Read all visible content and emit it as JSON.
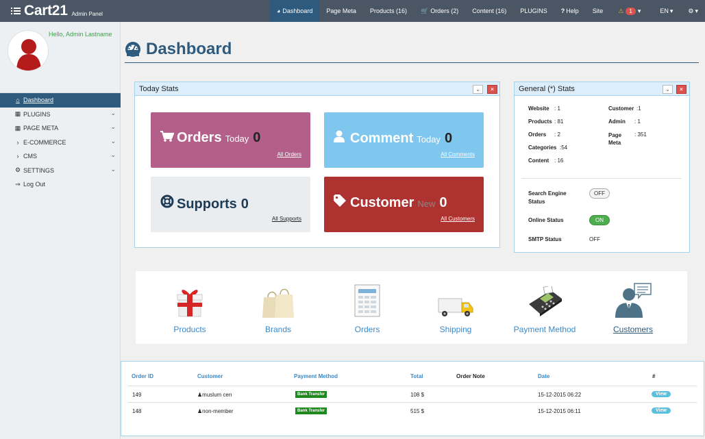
{
  "brand": {
    "title": "Cart21",
    "subtitle": "Admin Panel"
  },
  "nav": [
    {
      "label": "Dashboard",
      "icon": "gauge-icon"
    },
    {
      "label": "Page Meta"
    },
    {
      "label": "Products (16)"
    },
    {
      "label": "Orders (2)",
      "icon": "cart-icon"
    },
    {
      "label": "Content (16)"
    },
    {
      "label": "PLUGINS"
    },
    {
      "label": "Help",
      "icon": "question-icon"
    },
    {
      "label": "Site"
    },
    {
      "label": "1",
      "icon": "warning-icon"
    },
    {
      "label": "EN"
    },
    {
      "label": "",
      "icon": "gear-icon"
    }
  ],
  "sidebar": {
    "greeting": "Hello, Admin Lastname",
    "items": [
      {
        "label": "Dashboard",
        "icon": "home-icon"
      },
      {
        "label": "PLUGINS",
        "icon": "table-icon"
      },
      {
        "label": "PAGE META",
        "icon": "table-icon"
      },
      {
        "label": "E-COMMERCE",
        "icon": "chevron-right-icon"
      },
      {
        "label": "CMS",
        "icon": "chevron-right-icon"
      },
      {
        "label": "SETTINGS",
        "icon": "gear-icon"
      },
      {
        "label": "Log Out",
        "icon": "logout-icon"
      }
    ]
  },
  "page": {
    "title": "Dashboard"
  },
  "today_stats": {
    "title": "Today Stats",
    "tiles": [
      {
        "label": "Orders",
        "qualifier": "Today",
        "value": "0",
        "link": "All Orders",
        "color": "#b45f8a"
      },
      {
        "label": "Comment",
        "qualifier": "Today",
        "value": "0",
        "link": "All Comments",
        "color": "#7fc7ee"
      },
      {
        "label": "Supports",
        "qualifier": "",
        "value": "0",
        "link": "All Supports",
        "color": "#e9edf0"
      },
      {
        "label": "Customer",
        "qualifier": "New",
        "value": "0",
        "link": "All Customers",
        "color": "#ad3230"
      }
    ]
  },
  "general_stats": {
    "title": "General (*) Stats",
    "left": [
      {
        "key": "Website",
        "value": ": 1"
      },
      {
        "key": "Products",
        "value": ": 81"
      },
      {
        "key": "Orders",
        "value": ": 2"
      },
      {
        "key": "Categories",
        "value": ":54"
      },
      {
        "key": "Content",
        "value": ": 16"
      }
    ],
    "right": [
      {
        "key": "Customer",
        "value": ":1"
      },
      {
        "key": "Admin",
        "value": ": 1"
      },
      {
        "key": "Page Meta",
        "value": ": 351"
      }
    ],
    "settings": [
      {
        "key": "Search Engine Status",
        "value": "OFF"
      },
      {
        "key": "Online Status",
        "value": "ON"
      },
      {
        "key": "SMTP Status",
        "value": "OFF"
      }
    ]
  },
  "shortcuts": [
    {
      "label": "Products",
      "icon": "gift-box-icon"
    },
    {
      "label": "Brands",
      "icon": "shopping-bags-icon"
    },
    {
      "label": "Orders",
      "icon": "invoice-icon"
    },
    {
      "label": "Shipping",
      "icon": "delivery-truck-icon"
    },
    {
      "label": "Payment Method",
      "icon": "card-terminal-icon"
    },
    {
      "label": "Customers",
      "icon": "customer-support-icon"
    }
  ],
  "orders_table": {
    "headers": [
      "Order ID",
      "Customer",
      "Payment Method",
      "Total",
      "Order Note",
      "Date",
      "#"
    ],
    "rows": [
      {
        "id": "149",
        "customer": "muslum cen",
        "payment": "Bank Transfer",
        "total": "108 $",
        "note": "",
        "date": "15-12-2015 06:22",
        "action": "View"
      },
      {
        "id": "148",
        "customer": "non-member",
        "payment": "Bank Transfer",
        "total": "515 $",
        "note": "",
        "date": "15-12-2015 06:11",
        "action": "View"
      }
    ]
  }
}
